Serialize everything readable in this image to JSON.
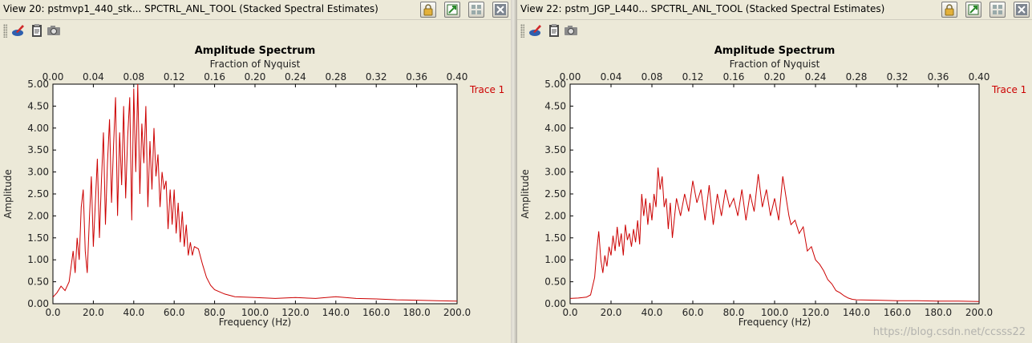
{
  "panels": [
    {
      "title": "View 20: pstmvp1_440_stk... SPCTRL_ANL_TOOL (Stacked Spectral Estimates)",
      "toolbar": [
        "erase-icon",
        "clipboard-icon",
        "camera-icon"
      ],
      "title_buttons": [
        "lock-icon",
        "restore-icon",
        "maximize-icon",
        "close-icon"
      ]
    },
    {
      "title": "View 22: pstm_JGP_L440... SPCTRL_ANL_TOOL (Stacked Spectral Estimates)",
      "toolbar": [
        "erase-icon",
        "clipboard-icon",
        "camera-icon"
      ],
      "title_buttons": [
        "lock-icon",
        "restore-icon",
        "maximize-icon",
        "close-icon"
      ]
    }
  ],
  "watermark": "https://blog.csdn.net/ccsss22",
  "colors": {
    "trace": "#cc0000",
    "window_bg": "#ece9d8",
    "plot_bg": "#ffffff"
  },
  "chart_data": [
    {
      "type": "line",
      "title": "Amplitude Spectrum",
      "xlabel": "Frequency (Hz)",
      "ylabel": "Amplitude",
      "top_axis_label": "Fraction of Nyquist",
      "xlim": [
        0,
        200
      ],
      "ylim": [
        0,
        5
      ],
      "top_xlim": [
        0,
        0.4
      ],
      "x_ticks": [
        "0.0",
        "20.0",
        "40.0",
        "60.0",
        "80.0",
        "100.0",
        "120.0",
        "140.0",
        "160.0",
        "180.0",
        "200.0"
      ],
      "top_ticks": [
        "0.00",
        "0.04",
        "0.08",
        "0.12",
        "0.16",
        "0.20",
        "0.24",
        "0.28",
        "0.32",
        "0.36",
        "0.40"
      ],
      "y_ticks": [
        "0.00",
        "0.50",
        "1.00",
        "1.50",
        "2.00",
        "2.50",
        "3.00",
        "3.50",
        "4.00",
        "4.50",
        "5.00"
      ],
      "grid": false,
      "series": [
        {
          "name": "Trace 1",
          "x": [
            0,
            2,
            4,
            6,
            8,
            10,
            11,
            12,
            13,
            14,
            15,
            16,
            17,
            18,
            19,
            20,
            21,
            22,
            23,
            24,
            25,
            26,
            27,
            28,
            29,
            30,
            31,
            32,
            33,
            34,
            35,
            36,
            37,
            38,
            39,
            40,
            41,
            42,
            43,
            44,
            45,
            46,
            47,
            48,
            49,
            50,
            51,
            52,
            53,
            54,
            55,
            56,
            57,
            58,
            59,
            60,
            61,
            62,
            63,
            64,
            65,
            66,
            67,
            68,
            69,
            70,
            72,
            74,
            76,
            78,
            80,
            85,
            90,
            100,
            110,
            120,
            130,
            140,
            150,
            160,
            170,
            180,
            190,
            200
          ],
          "y": [
            0.15,
            0.25,
            0.4,
            0.3,
            0.5,
            1.2,
            0.7,
            1.5,
            1.0,
            2.2,
            2.6,
            1.2,
            0.7,
            1.9,
            2.9,
            1.3,
            2.3,
            3.3,
            1.5,
            2.8,
            3.9,
            1.8,
            3.2,
            4.2,
            2.3,
            3.6,
            4.7,
            2.0,
            3.9,
            2.7,
            4.5,
            2.4,
            3.8,
            4.7,
            1.9,
            4.9,
            3.0,
            5.0,
            2.5,
            4.1,
            3.2,
            4.5,
            2.2,
            3.7,
            2.6,
            4.0,
            2.9,
            3.4,
            2.2,
            3.0,
            2.6,
            2.8,
            1.7,
            2.6,
            1.8,
            2.6,
            1.6,
            2.3,
            1.4,
            2.1,
            1.3,
            1.8,
            1.1,
            1.4,
            1.1,
            1.3,
            1.25,
            0.9,
            0.6,
            0.42,
            0.32,
            0.22,
            0.16,
            0.14,
            0.12,
            0.14,
            0.12,
            0.16,
            0.12,
            0.11,
            0.09,
            0.08,
            0.07,
            0.06
          ]
        }
      ]
    },
    {
      "type": "line",
      "title": "Amplitude Spectrum",
      "xlabel": "Frequency (Hz)",
      "ylabel": "Amplitude",
      "top_axis_label": "Fraction of Nyquist",
      "xlim": [
        0,
        200
      ],
      "ylim": [
        0,
        5
      ],
      "top_xlim": [
        0,
        0.4
      ],
      "x_ticks": [
        "0.0",
        "20.0",
        "40.0",
        "60.0",
        "80.0",
        "100.0",
        "120.0",
        "140.0",
        "160.0",
        "180.0",
        "200.0"
      ],
      "top_ticks": [
        "0.00",
        "0.04",
        "0.08",
        "0.12",
        "0.16",
        "0.20",
        "0.24",
        "0.28",
        "0.32",
        "0.36",
        "0.40"
      ],
      "y_ticks": [
        "0.00",
        "0.50",
        "1.00",
        "1.50",
        "2.00",
        "2.50",
        "3.00",
        "3.50",
        "4.00",
        "4.50",
        "5.00"
      ],
      "grid": false,
      "series": [
        {
          "name": "Trace 1",
          "x": [
            0,
            4,
            8,
            10,
            12,
            13,
            14,
            15,
            16,
            17,
            18,
            19,
            20,
            21,
            22,
            23,
            24,
            25,
            26,
            27,
            28,
            29,
            30,
            31,
            32,
            33,
            34,
            35,
            36,
            37,
            38,
            39,
            40,
            41,
            42,
            43,
            44,
            45,
            46,
            47,
            48,
            49,
            50,
            52,
            54,
            56,
            58,
            60,
            62,
            64,
            66,
            68,
            70,
            72,
            74,
            76,
            78,
            80,
            82,
            84,
            86,
            88,
            90,
            92,
            94,
            96,
            98,
            100,
            102,
            104,
            105,
            106,
            107,
            108,
            110,
            112,
            114,
            116,
            118,
            120,
            122,
            124,
            126,
            128,
            130,
            132,
            134,
            136,
            138,
            140,
            150,
            160,
            170,
            180,
            190,
            200
          ],
          "y": [
            0.12,
            0.13,
            0.15,
            0.2,
            0.6,
            1.2,
            1.65,
            1.0,
            0.7,
            1.1,
            0.85,
            1.3,
            1.1,
            1.55,
            1.2,
            1.75,
            1.3,
            1.6,
            1.1,
            1.8,
            1.45,
            1.6,
            1.3,
            1.7,
            1.4,
            1.9,
            1.35,
            2.5,
            2.0,
            2.4,
            1.8,
            2.3,
            1.9,
            2.5,
            2.2,
            3.1,
            2.6,
            2.9,
            2.2,
            2.4,
            1.7,
            2.3,
            1.5,
            2.4,
            2.0,
            2.5,
            2.1,
            2.8,
            2.3,
            2.6,
            1.9,
            2.7,
            1.8,
            2.5,
            2.0,
            2.6,
            2.2,
            2.4,
            2.0,
            2.6,
            1.9,
            2.5,
            2.1,
            2.95,
            2.2,
            2.6,
            2.0,
            2.4,
            1.9,
            2.9,
            2.6,
            2.3,
            2.0,
            1.8,
            1.9,
            1.6,
            1.75,
            1.2,
            1.3,
            1.0,
            0.9,
            0.75,
            0.55,
            0.45,
            0.3,
            0.25,
            0.18,
            0.13,
            0.1,
            0.09,
            0.08,
            0.07,
            0.07,
            0.06,
            0.06,
            0.05
          ]
        }
      ]
    }
  ]
}
